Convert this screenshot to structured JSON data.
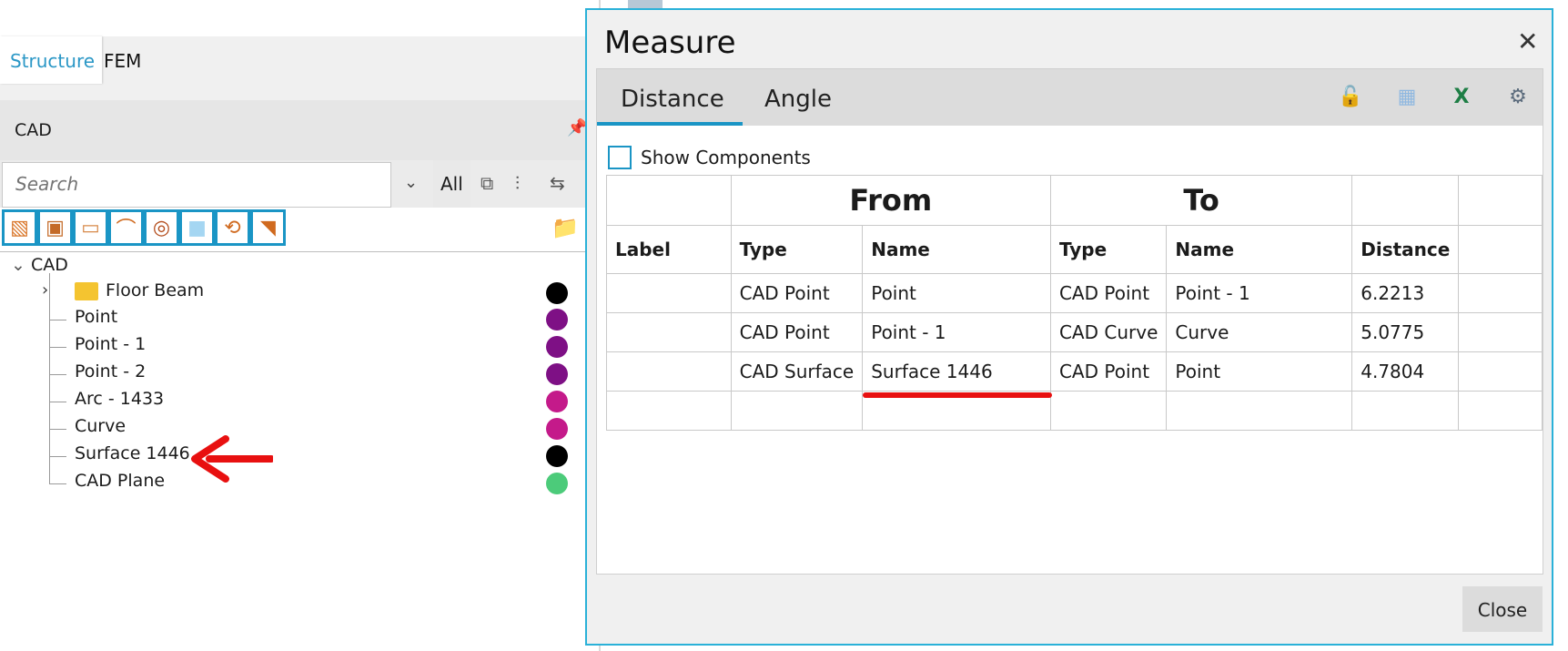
{
  "panel": {
    "tabs": [
      "Structure",
      "FEM"
    ],
    "section_title": "CAD",
    "search_placeholder": "Search",
    "filter_label": "All",
    "tree": {
      "root": "CAD",
      "items": [
        {
          "label": "Floor Beam",
          "color": "#000000"
        },
        {
          "label": "Point",
          "color": "#7e1085"
        },
        {
          "label": "Point - 1",
          "color": "#7e1085"
        },
        {
          "label": "Point - 2",
          "color": "#7e1085"
        },
        {
          "label": "Arc - 1433",
          "color": "#c41a8a"
        },
        {
          "label": "Curve",
          "color": "#c41a8a"
        },
        {
          "label": "Surface 1446",
          "color": "#000000"
        },
        {
          "label": "CAD Plane",
          "color": "#4ccb7a"
        }
      ]
    }
  },
  "dialog": {
    "title": "Measure",
    "tabs": [
      "Distance",
      "Angle"
    ],
    "show_components": "Show Components",
    "groups": {
      "from": "From",
      "to": "To"
    },
    "headers": [
      "Label",
      "Type",
      "Name",
      "Type",
      "Name",
      "Distance",
      ""
    ],
    "rows": [
      [
        "",
        "CAD Point",
        "Point",
        "CAD Point",
        "Point - 1",
        "6.2213",
        ""
      ],
      [
        "",
        "CAD Point",
        "Point - 1",
        "CAD Curve",
        "Curve",
        "5.0775",
        ""
      ],
      [
        "",
        "CAD Surface",
        "Surface 1446",
        "CAD Point",
        "Point",
        "4.7804",
        ""
      ],
      [
        "",
        "",
        "",
        "",
        "",
        "",
        ""
      ]
    ],
    "close_label": "Close"
  }
}
